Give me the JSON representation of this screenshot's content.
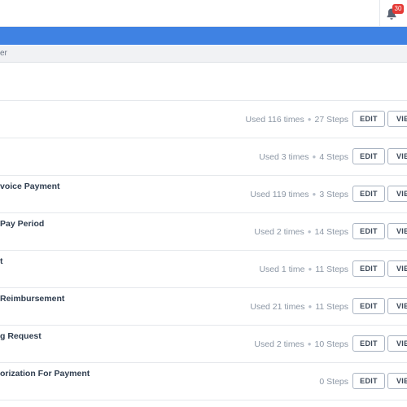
{
  "header": {
    "notification_count": "30",
    "notification_color": "#e53935",
    "accent_color": "#3f82e3",
    "bell_icon": "bell-icon"
  },
  "subbar": {
    "text": "er"
  },
  "buttons": {
    "edit_label": "EDIT",
    "view_label": "VIE"
  },
  "rows": [
    {
      "title": "",
      "usage": "Used 116 times",
      "steps": "27 Steps"
    },
    {
      "title": "",
      "usage": "Used 3 times",
      "steps": "4 Steps"
    },
    {
      "title": "voice Payment",
      "usage": "Used 119 times",
      "steps": "3 Steps"
    },
    {
      "title": "Pay Period",
      "usage": "Used 2 times",
      "steps": "14 Steps"
    },
    {
      "title": "t",
      "usage": "Used 1 time",
      "steps": "11 Steps"
    },
    {
      "title": "Reimbursement",
      "usage": "Used 21 times",
      "steps": "11 Steps"
    },
    {
      "title": "g Request",
      "usage": "Used 2 times",
      "steps": "10 Steps"
    },
    {
      "title": "orization For Payment",
      "usage": "",
      "steps": "0 Steps"
    }
  ]
}
